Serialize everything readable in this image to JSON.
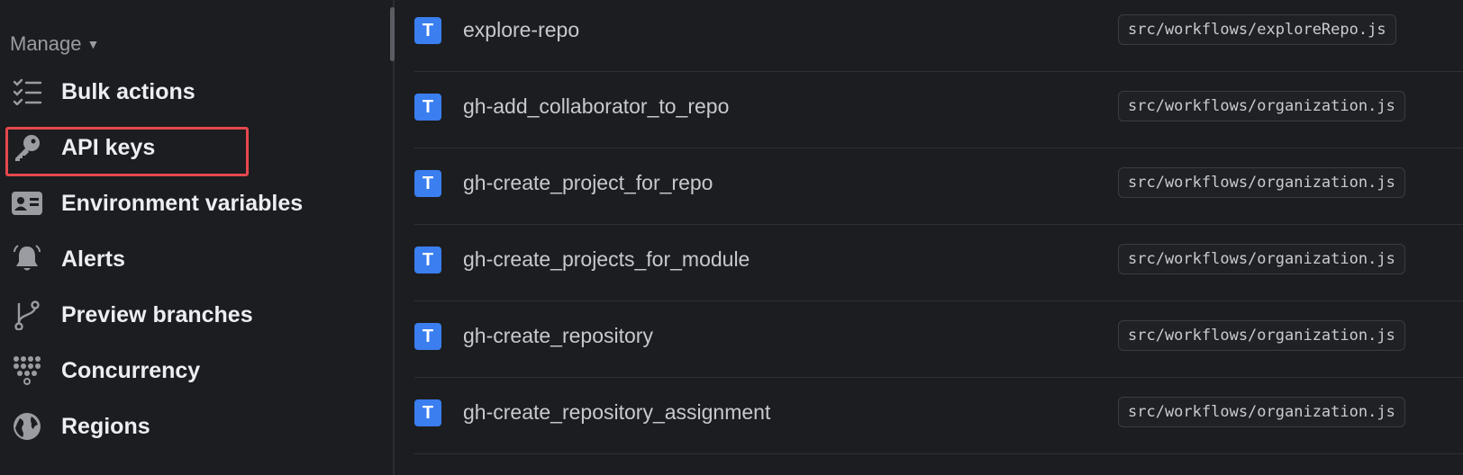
{
  "sidebar": {
    "section_title": "Manage",
    "items": [
      {
        "label": "Bulk actions",
        "icon": "checklist-icon"
      },
      {
        "label": "API keys",
        "icon": "key-icon"
      },
      {
        "label": "Environment variables",
        "icon": "id-card-icon"
      },
      {
        "label": "Alerts",
        "icon": "bell-icon"
      },
      {
        "label": "Preview branches",
        "icon": "git-branch-icon"
      },
      {
        "label": "Concurrency",
        "icon": "dots-grid-icon"
      },
      {
        "label": "Regions",
        "icon": "globe-icon"
      }
    ]
  },
  "tasks": [
    {
      "badge": "T",
      "name": "explore-repo",
      "path": "src/workflows/exploreRepo.js"
    },
    {
      "badge": "T",
      "name": "gh-add_collaborator_to_repo",
      "path": "src/workflows/organization.js"
    },
    {
      "badge": "T",
      "name": "gh-create_project_for_repo",
      "path": "src/workflows/organization.js"
    },
    {
      "badge": "T",
      "name": "gh-create_projects_for_module",
      "path": "src/workflows/organization.js"
    },
    {
      "badge": "T",
      "name": "gh-create_repository",
      "path": "src/workflows/organization.js"
    },
    {
      "badge": "T",
      "name": "gh-create_repository_assignment",
      "path": "src/workflows/organization.js"
    }
  ],
  "colors": {
    "accent": "#3a7ef0",
    "highlight": "#e5484d"
  }
}
